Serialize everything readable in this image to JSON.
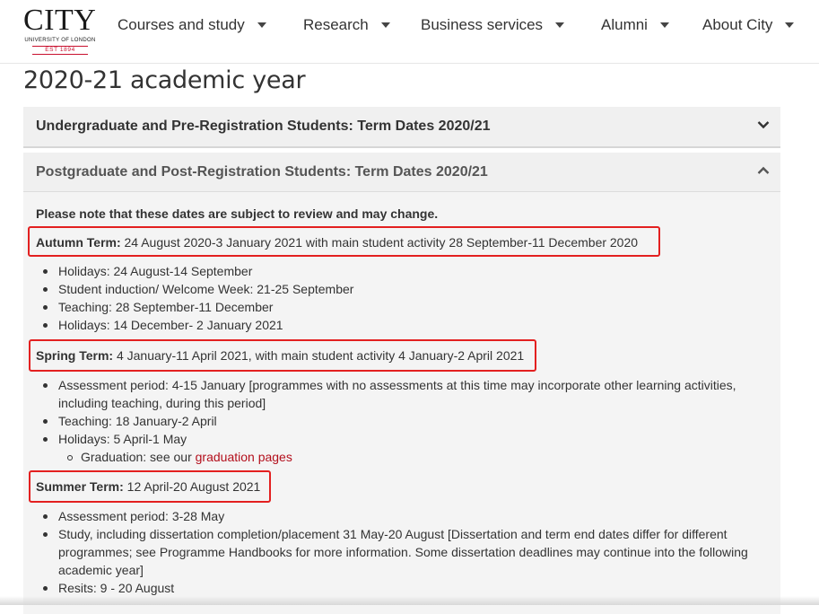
{
  "header": {
    "logo": {
      "name": "CITY",
      "subtitle": "UNIVERSITY OF LONDON",
      "est": "EST 1894"
    },
    "nav": [
      {
        "label": "Courses and study"
      },
      {
        "label": "Research"
      },
      {
        "label": "Business services"
      },
      {
        "label": "Alumni"
      },
      {
        "label": "About City"
      }
    ]
  },
  "page": {
    "title": "2020-21 academic year"
  },
  "accordions": [
    {
      "title": "Undergraduate and Pre-Registration Students: Term Dates 2020/21",
      "state": "collapsed",
      "icon": "chevron-down-icon"
    },
    {
      "title": "Postgraduate and Post-Registration Students: Term Dates 2020/21",
      "state": "expanded",
      "icon": "chevron-up-icon"
    }
  ],
  "content": {
    "note": "Please note that these dates are subject to review and may change.",
    "autumn": {
      "label": "Autumn Term:",
      "text": " 24 August 2020-3 January 2021 with main student activity 28 September-11 December 2020",
      "items": [
        "Holidays: 24 August-14 September",
        "Student induction/ Welcome Week: 21-25 September",
        "Teaching: 28 September-11 December",
        "Holidays: 14 December- 2 January 2021"
      ]
    },
    "spring": {
      "label": "Spring Term:",
      "text": " 4 January-11 April 2021, with main student activity 4 January-2 April 2021",
      "items": [
        "Assessment period: 4-15 January [programmes with no assessments at this time may incorporate other learning activities, including teaching, during this period]",
        "Teaching: 18 January-2 April",
        "Holidays: 5 April-1 May"
      ],
      "graduation_prefix": "Graduation: see our ",
      "graduation_link": "graduation pages"
    },
    "summer": {
      "label": "Summer Term:",
      "text": " 12 April-20 August 2021",
      "items": [
        "Assessment period: 3-28 May",
        "Study, including dissertation completion/placement 31 May-20 August [Dissertation and term end dates differ for different programmes; see Programme Handbooks for more information. Some dissertation deadlines may continue into the following academic year]",
        "Resits: 9 - 20 August"
      ]
    }
  },
  "colors": {
    "highlight_box": "#e32020",
    "link": "#b30e1b",
    "accordion_bg": "#f0f0f0",
    "brand_red": "#c8102e"
  }
}
